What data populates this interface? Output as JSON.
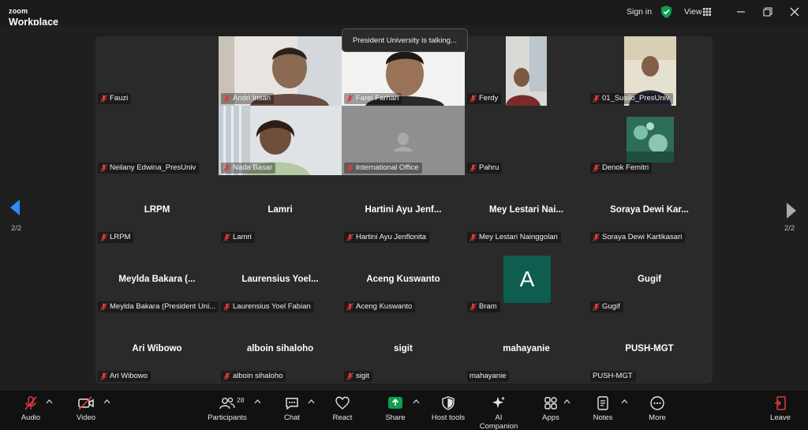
{
  "app": {
    "brand_small": "zoom",
    "brand": "Workplace"
  },
  "titlebar": {
    "signin": "Sign in",
    "view": "View"
  },
  "talking": "President University is talking...",
  "pagination": {
    "left": "2/2",
    "right": "2/2"
  },
  "tiles": [
    {
      "id": "fauzi",
      "tag": "Fauzi",
      "big": ""
    },
    {
      "id": "andri",
      "tag": "Andri Insan",
      "big": ""
    },
    {
      "id": "farel",
      "tag": "Farel Farhan",
      "big": ""
    },
    {
      "id": "ferdy",
      "tag": "Ferdy",
      "big": ""
    },
    {
      "id": "susilo",
      "tag": "01_Susilo_PresUniv",
      "big": ""
    },
    {
      "id": "neilany",
      "tag": "Neilany Edwina_PresUniv",
      "big": ""
    },
    {
      "id": "nada",
      "tag": "Nada Basar",
      "big": ""
    },
    {
      "id": "intl",
      "tag": "International Office",
      "big": ""
    },
    {
      "id": "pahru",
      "tag": "Pahru",
      "big": ""
    },
    {
      "id": "denok",
      "tag": "Denok Femitri",
      "big": ""
    },
    {
      "id": "lrpm",
      "tag": "LRPM",
      "big": "LRPM"
    },
    {
      "id": "lamri",
      "tag": "Lamri",
      "big": "Lamri"
    },
    {
      "id": "hartini",
      "tag": "Hartini Ayu Jenflonita",
      "big": "Hartini Ayu Jenf..."
    },
    {
      "id": "mey",
      "tag": "Mey Lestari Nainggolan",
      "big": "Mey Lestari Nai..."
    },
    {
      "id": "soraya",
      "tag": "Soraya Dewi Kartikasari",
      "big": "Soraya Dewi Kar..."
    },
    {
      "id": "meylda",
      "tag": "Meylda Bakara (President Uni...",
      "big": "Meylda Bakara (..."
    },
    {
      "id": "laurensius",
      "tag": "Laurensius Yoel Fabian",
      "big": "Laurensius Yoel..."
    },
    {
      "id": "aceng",
      "tag": "Aceng Kuswanto",
      "big": "Aceng Kuswanto"
    },
    {
      "id": "bram",
      "tag": "Bram",
      "big": "",
      "avatar": "A"
    },
    {
      "id": "gugif",
      "tag": "Gugif",
      "big": "Gugif"
    },
    {
      "id": "ari",
      "tag": "Ari Wibowo",
      "big": "Ari Wibowo"
    },
    {
      "id": "alboin",
      "tag": "alboin sihaloho",
      "big": "alboin sihaloho"
    },
    {
      "id": "sigit",
      "tag": "sigit",
      "big": "sigit"
    },
    {
      "id": "mahayanie",
      "tag": "mahayanie",
      "big": "mahayanie"
    },
    {
      "id": "pushmgt",
      "tag": "PUSH-MGT",
      "big": "PUSH-MGT"
    }
  ],
  "toolbar": {
    "audio": "Audio",
    "video": "Video",
    "participants": "Participants",
    "participants_count": "28",
    "chat": "Chat",
    "react": "React",
    "share": "Share",
    "host_tools": "Host tools",
    "ai_companion": "AI Companion",
    "apps": "Apps",
    "notes": "Notes",
    "more": "More",
    "leave": "Leave"
  },
  "colors": {
    "accent_green": "#0e9f4f",
    "muted_red": "#e0393e",
    "avatar_teal": "#0d5e4f",
    "nav_blue": "#2d8cff"
  }
}
